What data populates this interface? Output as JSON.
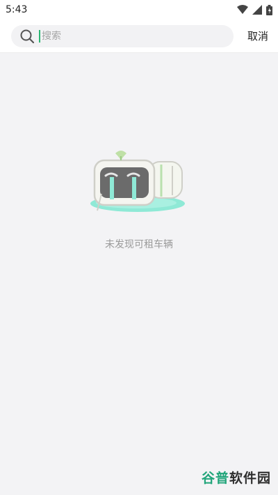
{
  "status_bar": {
    "time": "5:43",
    "icons": [
      "wifi-icon",
      "signal-icon",
      "battery-icon"
    ]
  },
  "search": {
    "placeholder": "搜索",
    "value": "",
    "cancel_label": "取消"
  },
  "empty_state": {
    "message": "未发现可租车辆",
    "illustration": "crying-mascot-illustration"
  },
  "watermark": {
    "accent_text": "谷普",
    "text": "软件园"
  },
  "colors": {
    "background": "#f3f3f5",
    "accent": "#2bb673",
    "tear": "#7fe5cf"
  }
}
